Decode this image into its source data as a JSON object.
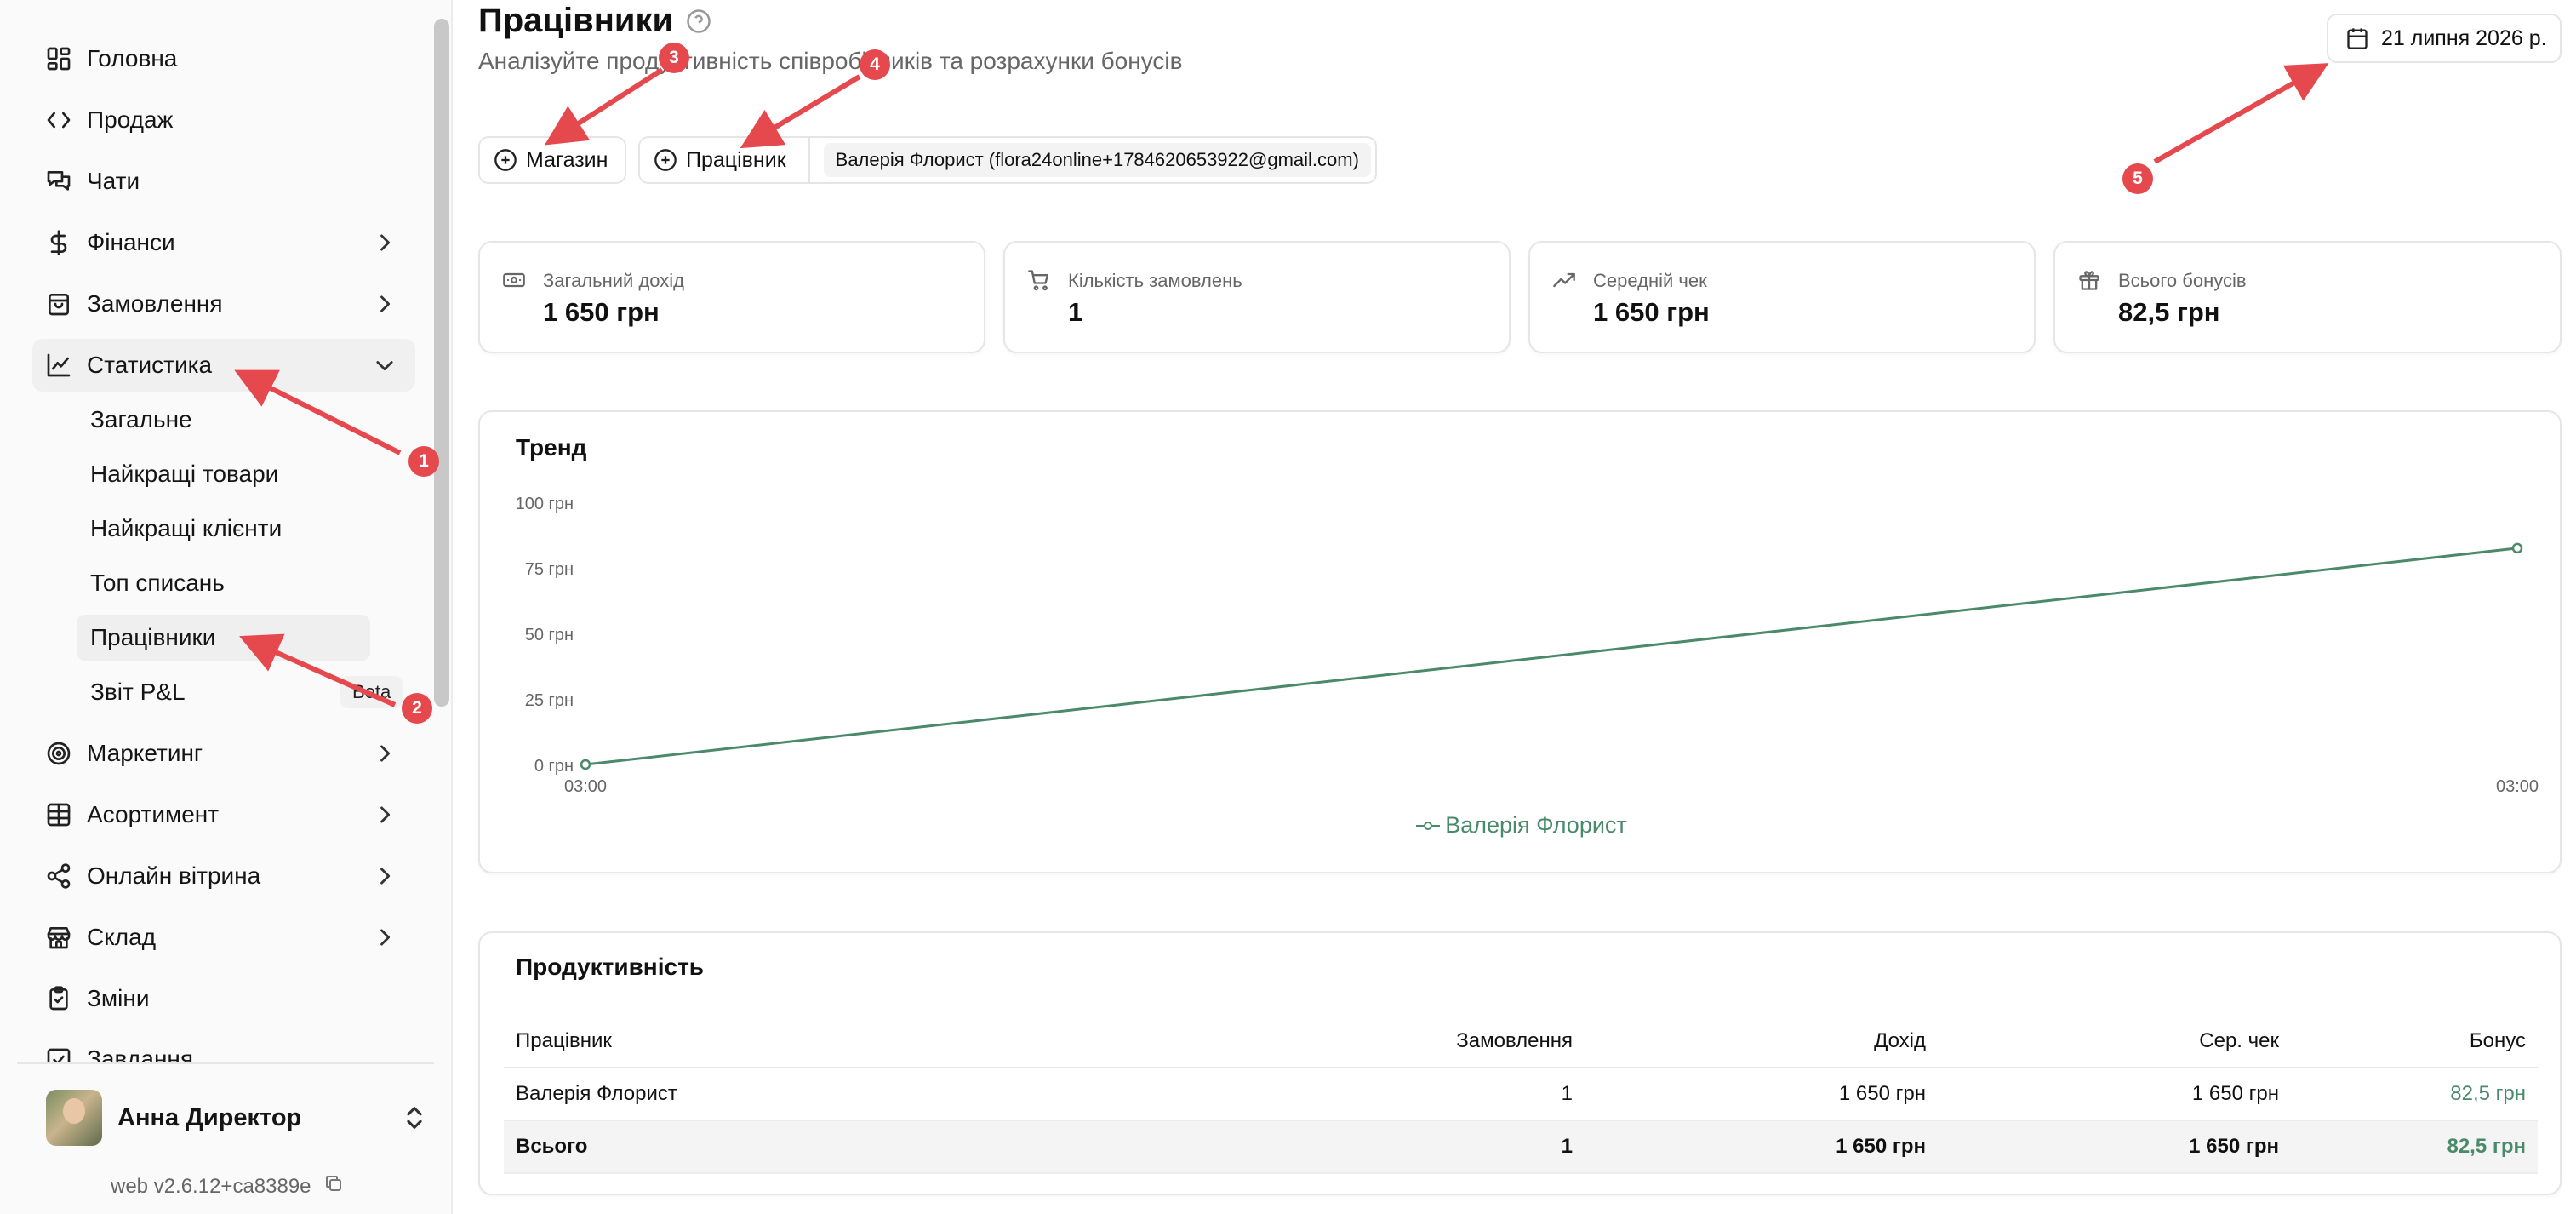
{
  "sidebar": {
    "items": [
      {
        "label": "Головна",
        "icon": "dashboard-grid-icon"
      },
      {
        "label": "Продаж",
        "icon": "code-brackets-icon"
      },
      {
        "label": "Чати",
        "icon": "chat-bubbles-icon"
      },
      {
        "label": "Фінанси",
        "icon": "dollar-icon"
      },
      {
        "label": "Замовлення",
        "icon": "shopping-bag-icon"
      },
      {
        "label": "Статистика",
        "icon": "line-chart-icon"
      },
      {
        "label": "Маркетинг",
        "icon": "target-icon"
      },
      {
        "label": "Асортимент",
        "icon": "table-grid-icon"
      },
      {
        "label": "Онлайн вітрина",
        "icon": "share-icon"
      },
      {
        "label": "Склад",
        "icon": "store-icon"
      },
      {
        "label": "Зміни",
        "icon": "clipboard-check-icon"
      },
      {
        "label": "Завдання",
        "icon": "checkbox-icon"
      }
    ],
    "stats_sub": [
      {
        "label": "Загальне"
      },
      {
        "label": "Найкращі товари"
      },
      {
        "label": "Найкращі клієнти"
      },
      {
        "label": "Топ списань"
      },
      {
        "label": "Працівники"
      },
      {
        "label": "Звіт P&L"
      }
    ],
    "beta_badge": "Beta",
    "user_name": "Анна Директор",
    "version": "web v2.6.12+ca8389e"
  },
  "header": {
    "title": "Працівники",
    "subtitle": "Аналізуйте продуктивність співробітників та розрахунки бонусів",
    "date": "21 липня 2026 р."
  },
  "filters": {
    "store_label": "Магазин",
    "employee_label": "Працівник",
    "employee_selected": "Валерія Флорист (flora24online+1784620653922@gmail.com)"
  },
  "stats": [
    {
      "label": "Загальний дохід",
      "value": "1 650 грн",
      "icon": "cash-icon"
    },
    {
      "label": "Кількість замовлень",
      "value": "1",
      "icon": "cart-icon"
    },
    {
      "label": "Середній чек",
      "value": "1 650 грн",
      "icon": "trending-up-icon"
    },
    {
      "label": "Всього бонусів",
      "value": "82,5 грн",
      "icon": "gift-icon"
    }
  ],
  "trend": {
    "title": "Тренд"
  },
  "chart_data": {
    "type": "line",
    "title": "Тренд",
    "x": [
      "03:00",
      "03:00"
    ],
    "series": [
      {
        "name": "Валерія Флорист",
        "values": [
          0,
          82.5
        ]
      }
    ],
    "yticks": [
      "0 грн",
      "25 грн",
      "50 грн",
      "75 грн",
      "100 грн"
    ],
    "ylim": [
      0,
      100
    ],
    "xlabel": "",
    "ylabel": "",
    "legend": "bottom-center",
    "color": "#4a8a6a",
    "grid": false
  },
  "performance": {
    "title": "Продуктивність",
    "headers": [
      "Працівник",
      "Замовлення",
      "Дохід",
      "Сер. чек",
      "Бонус"
    ],
    "rows": [
      [
        "Валерія Флорист",
        "1",
        "1 650 грн",
        "1 650 грн",
        "82,5 грн"
      ]
    ],
    "total": [
      "Всього",
      "1",
      "1 650 грн",
      "1 650 грн",
      "82,5 грн"
    ]
  },
  "annotations": [
    "1",
    "2",
    "3",
    "4",
    "5"
  ],
  "colors": {
    "accent": "#4a8a6a",
    "annotation": "#e5484d"
  }
}
